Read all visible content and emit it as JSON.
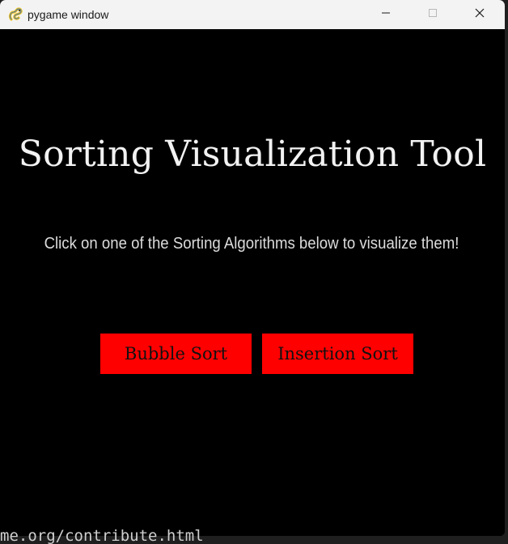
{
  "window": {
    "title": "pygame window",
    "app_icon": "pygame-snake-icon",
    "controls": {
      "minimize_icon": "minimize-icon",
      "maximize_icon": "maximize-icon",
      "close_icon": "close-icon"
    }
  },
  "main": {
    "heading": "Sorting Visualization Tool",
    "instruction": "Click on one of the Sorting Algorithms below to visualize them!",
    "buttons": {
      "bubble_sort": "Bubble Sort",
      "insertion_sort": "Insertion Sort"
    }
  },
  "background_terminal": {
    "text": "me.org/contribute.html"
  },
  "colors": {
    "canvas_background": "#000000",
    "heading_text": "#f2f2f2",
    "instruction_text": "#dcdcdc",
    "button_fill": "#ff0000",
    "button_text": "#111111",
    "titlebar": "#f3f3f3"
  }
}
